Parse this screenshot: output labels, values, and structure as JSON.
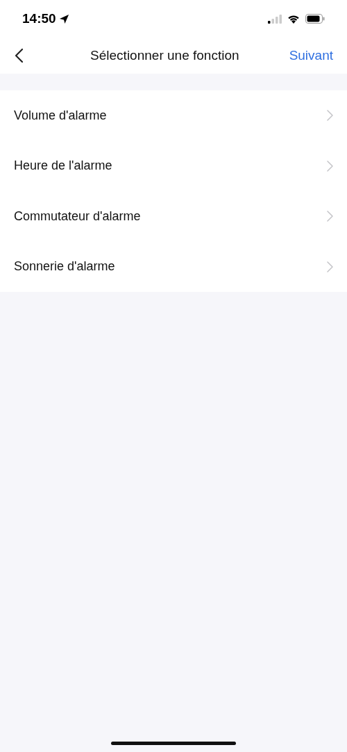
{
  "status_bar": {
    "time": "14:50"
  },
  "nav_bar": {
    "title": "Sélectionner une fonction",
    "action": "Suivant"
  },
  "items": [
    {
      "label": "Volume d'alarme"
    },
    {
      "label": "Heure de l'alarme"
    },
    {
      "label": "Commutateur d'alarme"
    },
    {
      "label": "Sonnerie d'alarme"
    }
  ]
}
